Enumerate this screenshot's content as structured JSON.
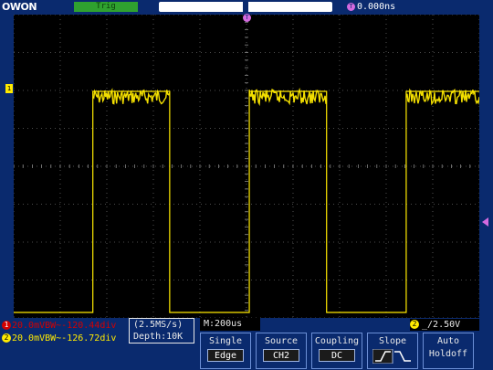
{
  "header": {
    "logo": "OWON",
    "trig_status": "Trig",
    "offset_marker": "T",
    "trigger_offset": "0.000ns"
  },
  "markers": {
    "trigger_position": "T",
    "ch1": "1"
  },
  "channels": [
    {
      "num": "1",
      "text": "20.0mVBW~-120.44div",
      "color": "#d40000"
    },
    {
      "num": "2",
      "text": "20.0mVBW~-126.72div",
      "color": "#ffea00"
    }
  ],
  "acquisition": {
    "sample_rate": "(2.5MS/s)",
    "depth": "Depth:10K",
    "timebase": "M:200us"
  },
  "trigger_level": {
    "channel": "2",
    "slope_symbol": "_/",
    "value": "2.50V"
  },
  "menu": [
    {
      "label": "Single",
      "value": "Edge"
    },
    {
      "label": "Source",
      "value": "CH2"
    },
    {
      "label": "Coupling",
      "value": "DC"
    },
    {
      "label": "Slope",
      "value": "rising"
    },
    {
      "label": "Auto",
      "value": "Holdoff"
    }
  ],
  "colors": {
    "trace": "#ffea00",
    "background": "#0a2a6e",
    "trig_badge": "#2fa12f",
    "marker": "#d46adf"
  },
  "waveform": {
    "type": "square",
    "pulses": [
      {
        "start_div": 1.7,
        "end_div": 3.35
      },
      {
        "start_div": 5.06,
        "end_div": 6.72
      },
      {
        "start_div": 8.43,
        "end_div": 10.0
      }
    ]
  }
}
